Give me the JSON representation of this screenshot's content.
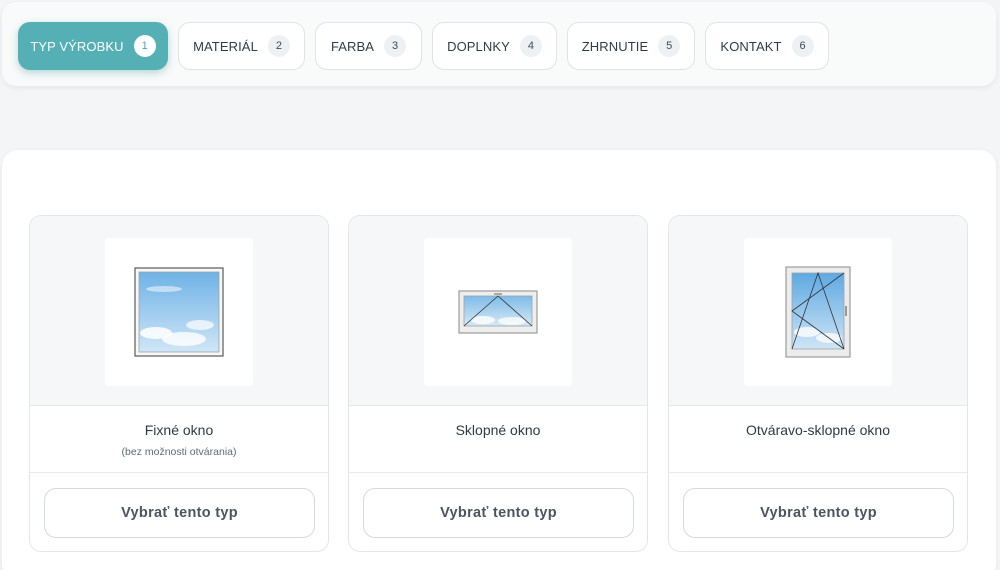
{
  "steps": [
    {
      "label": "TYP VÝROBKU",
      "num": "1",
      "active": true
    },
    {
      "label": "MATERIÁL",
      "num": "2"
    },
    {
      "label": "FARBA",
      "num": "3"
    },
    {
      "label": "DOPLNKY",
      "num": "4"
    },
    {
      "label": "ZHRNUTIE",
      "num": "5"
    },
    {
      "label": "KONTAKT",
      "num": "6"
    }
  ],
  "cards": [
    {
      "title": "Fixné okno",
      "subtitle": "(bez možnosti otvárania)",
      "button": "Vybrať tento typ",
      "icon": "fixed-window-icon"
    },
    {
      "title": "Sklopné okno",
      "subtitle": "",
      "button": "Vybrať tento typ",
      "icon": "tilt-window-icon"
    },
    {
      "title": "Otváravo-sklopné okno",
      "subtitle": "",
      "button": "Vybrať tento typ",
      "icon": "tilt-turn-window-icon"
    }
  ],
  "colors": {
    "accent": "#55b0b6",
    "sky": "#a9d3ef"
  }
}
